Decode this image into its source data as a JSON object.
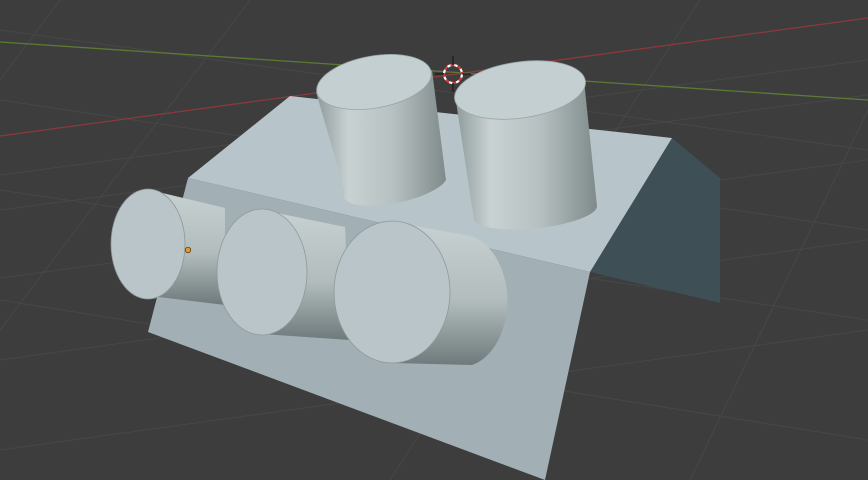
{
  "viewport": {
    "view_name": "",
    "background_color": "#3d3d3d",
    "grid_color": "#484848",
    "x_axis_color": "#8a3a3a",
    "y_axis_color": "#5b7a34"
  },
  "scene": {
    "material_color": "#b7c5cb",
    "shadow_color": "#3d4e55",
    "origin_dot_color": "#e8962a",
    "cursor_icon": "3d-cursor-icon"
  }
}
